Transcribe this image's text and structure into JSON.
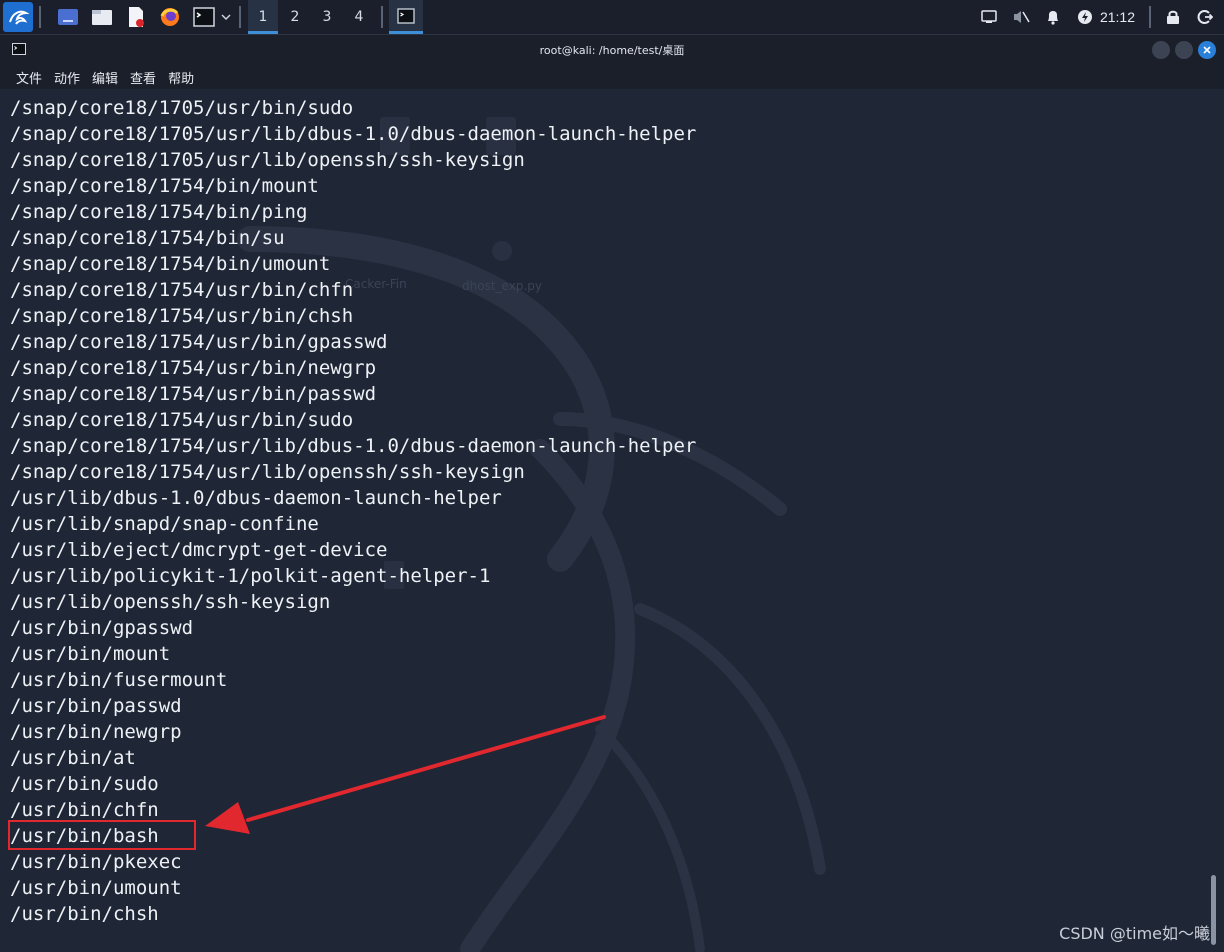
{
  "panel": {
    "workspaces": [
      "1",
      "2",
      "3",
      "4"
    ],
    "active_workspace": "1",
    "clock": "21:12",
    "launcher_icons": [
      "workspace-switcher-icon",
      "file-manager-icon",
      "text-editor-icon",
      "firefox-icon",
      "terminal-icon"
    ],
    "tray_icons": [
      "network-icon",
      "volume-muted-icon",
      "notification-bell-icon",
      "power-icon",
      "lock-icon",
      "logout-icon"
    ],
    "accent": "#3f8fd8"
  },
  "window": {
    "title": "root@kali: /home/test/桌面",
    "menu": [
      "文件",
      "动作",
      "编辑",
      "查看",
      "帮助"
    ]
  },
  "terminal": {
    "lines": [
      "/snap/core18/1705/usr/bin/sudo",
      "/snap/core18/1705/usr/lib/dbus-1.0/dbus-daemon-launch-helper",
      "/snap/core18/1705/usr/lib/openssh/ssh-keysign",
      "/snap/core18/1754/bin/mount",
      "/snap/core18/1754/bin/ping",
      "/snap/core18/1754/bin/su",
      "/snap/core18/1754/bin/umount",
      "/snap/core18/1754/usr/bin/chfn",
      "/snap/core18/1754/usr/bin/chsh",
      "/snap/core18/1754/usr/bin/gpasswd",
      "/snap/core18/1754/usr/bin/newgrp",
      "/snap/core18/1754/usr/bin/passwd",
      "/snap/core18/1754/usr/bin/sudo",
      "/snap/core18/1754/usr/lib/dbus-1.0/dbus-daemon-launch-helper",
      "/snap/core18/1754/usr/lib/openssh/ssh-keysign",
      "/usr/lib/dbus-1.0/dbus-daemon-launch-helper",
      "/usr/lib/snapd/snap-confine",
      "/usr/lib/eject/dmcrypt-get-device",
      "/usr/lib/policykit-1/polkit-agent-helper-1",
      "/usr/lib/openssh/ssh-keysign",
      "/usr/bin/gpasswd",
      "/usr/bin/mount",
      "/usr/bin/fusermount",
      "/usr/bin/passwd",
      "/usr/bin/newgrp",
      "/usr/bin/at",
      "/usr/bin/sudo",
      "/usr/bin/chfn",
      "/usr/bin/bash",
      "/usr/bin/pkexec",
      "/usr/bin/umount",
      "/usr/bin/chsh"
    ],
    "highlighted_line": "/usr/bin/bash",
    "annotation_color": "#e0282e"
  },
  "desktop_labels": [
    "Cacker-Fin",
    "dhost_exp.py"
  ],
  "watermark": "CSDN @time如～曦"
}
